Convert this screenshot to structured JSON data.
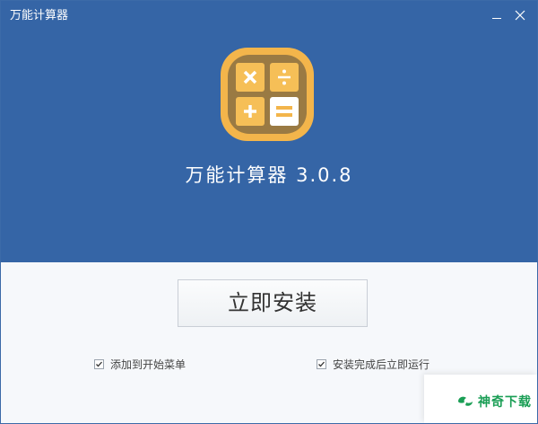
{
  "window": {
    "title": "万能计算器",
    "minimize_icon": "minimize-icon",
    "close_icon": "close-icon"
  },
  "hero": {
    "app_icon": "calculator-app-icon",
    "app_name": "万能计算器 3.0.8"
  },
  "actions": {
    "install_label": "立即安装"
  },
  "options": {
    "start_menu": {
      "label": "添加到开始菜单",
      "checked": true
    },
    "run_after": {
      "label": "安装完成后立即运行",
      "checked": true
    }
  },
  "watermark": {
    "text": "神奇下载",
    "icon": "shenqi-logo-icon"
  },
  "colors": {
    "header_bg": "#3565a6",
    "icon_frame": "#f3b54b",
    "icon_inner": "#9a7a43",
    "icon_key": "#f6bf57",
    "watermark_green": "#1a9e55"
  }
}
